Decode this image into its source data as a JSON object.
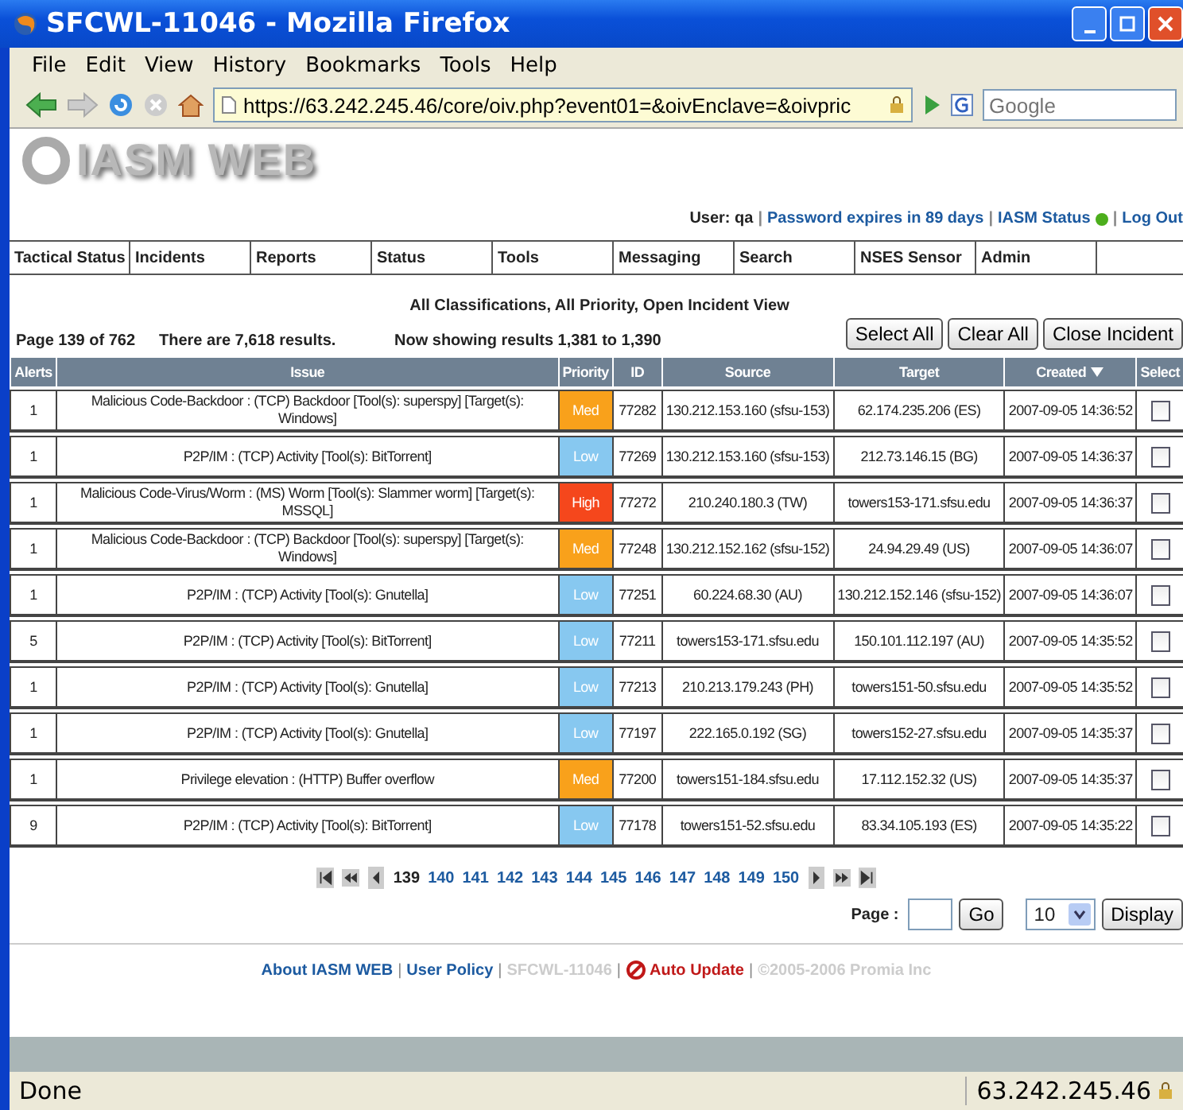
{
  "window": {
    "title": "SFCWL-11046 - Mozilla Firefox"
  },
  "menu": [
    "File",
    "Edit",
    "View",
    "History",
    "Bookmarks",
    "Tools",
    "Help"
  ],
  "address": "https://63.242.245.46/core/oiv.php?event01=&oivEnclave=&oivpric",
  "search": {
    "placeholder": "Google"
  },
  "header": {
    "logo": "IASM WEB",
    "items": [
      {
        "kind": "text",
        "text": "User: qa"
      },
      {
        "kind": "sep",
        "text": "|"
      },
      {
        "kind": "link",
        "text": "Password expires in 89 days"
      },
      {
        "kind": "sep",
        "text": "|"
      },
      {
        "kind": "link",
        "text": "IASM Status"
      },
      {
        "kind": "dot",
        "color": "#4cae1c"
      },
      {
        "kind": "sep",
        "text": "|"
      },
      {
        "kind": "link",
        "text": "Log Out"
      }
    ]
  },
  "tabs": [
    {
      "label": "Tactical Status"
    },
    {
      "label": "Incidents"
    },
    {
      "label": "Reports"
    },
    {
      "label": "Status"
    },
    {
      "label": "Tools"
    },
    {
      "label": "Messaging"
    },
    {
      "label": "Search"
    },
    {
      "label": "NSES Sensor"
    },
    {
      "label": "Admin"
    }
  ],
  "view_title": "All Classifications,  All  Priority, Open Incident View",
  "page_info": "Page 139 of 762",
  "results": "There are 7,618 results.",
  "showing": "Now showing results 1,381 to 1,390",
  "actions": [
    "Select All",
    "Clear All",
    "Close Incident"
  ],
  "columns": [
    "Alerts",
    "Issue",
    "Priority",
    "ID",
    "Source",
    "Target",
    "Created",
    "Select"
  ],
  "rows": [
    {
      "alerts": "1",
      "issue": "Malicious Code-Backdoor : (TCP) Backdoor [Tool(s): superspy] [Target(s): Windows]",
      "priority": {
        "text": "Med",
        "color": "#f9a11b"
      },
      "id": "77282",
      "source": "130.212.153.160 (sfsu-153)",
      "target": "62.174.235.206 (ES)",
      "created": "2007-09-05 14:36:52",
      "checked": false
    },
    {
      "alerts": "1",
      "issue": "P2P/IM : (TCP) Activity [Tool(s): BitTorrent]",
      "priority": {
        "text": "Low",
        "color": "#87c8f0"
      },
      "id": "77269",
      "source": "130.212.153.160 (sfsu-153)",
      "target": "212.73.146.15 (BG)",
      "created": "2007-09-05 14:36:37",
      "checked": false
    },
    {
      "alerts": "1",
      "issue": "Malicious Code-Virus/Worm : (MS) Worm [Tool(s): Slammer worm] [Target(s): MSSQL]",
      "priority": {
        "text": "High",
        "color": "#f5471c"
      },
      "id": "77272",
      "source": "210.240.180.3 (TW)",
      "target": "towers153-171.sfsu.edu",
      "created": "2007-09-05 14:36:37",
      "checked": false
    },
    {
      "alerts": "1",
      "issue": "Malicious Code-Backdoor : (TCP) Backdoor [Tool(s): superspy] [Target(s): Windows]",
      "priority": {
        "text": "Med",
        "color": "#f9a11b"
      },
      "id": "77248",
      "source": "130.212.152.162 (sfsu-152)",
      "target": "24.94.29.49 (US)",
      "created": "2007-09-05 14:36:07",
      "checked": false
    },
    {
      "alerts": "1",
      "issue": "P2P/IM : (TCP) Activity [Tool(s): Gnutella]",
      "priority": {
        "text": "Low",
        "color": "#87c8f0"
      },
      "id": "77251",
      "source": "60.224.68.30 (AU)",
      "target": "130.212.152.146 (sfsu-152)",
      "created": "2007-09-05 14:36:07",
      "checked": false
    },
    {
      "alerts": "5",
      "issue": "P2P/IM : (TCP) Activity [Tool(s): BitTorrent]",
      "priority": {
        "text": "Low",
        "color": "#87c8f0"
      },
      "id": "77211",
      "source": "towers153-171.sfsu.edu",
      "target": "150.101.112.197 (AU)",
      "created": "2007-09-05 14:35:52",
      "checked": false
    },
    {
      "alerts": "1",
      "issue": "P2P/IM : (TCP) Activity [Tool(s): Gnutella]",
      "priority": {
        "text": "Low",
        "color": "#87c8f0"
      },
      "id": "77213",
      "source": "210.213.179.243 (PH)",
      "target": "towers151-50.sfsu.edu",
      "created": "2007-09-05 14:35:52",
      "checked": false
    },
    {
      "alerts": "1",
      "issue": "P2P/IM : (TCP) Activity [Tool(s): Gnutella]",
      "priority": {
        "text": "Low",
        "color": "#87c8f0"
      },
      "id": "77197",
      "source": "222.165.0.192 (SG)",
      "target": "towers152-27.sfsu.edu",
      "created": "2007-09-05 14:35:37",
      "checked": false
    },
    {
      "alerts": "1",
      "issue": "Privilege elevation : (HTTP) Buffer overflow",
      "priority": {
        "text": "Med",
        "color": "#f9a11b"
      },
      "id": "77200",
      "source": "towers151-184.sfsu.edu",
      "target": "17.112.152.32 (US)",
      "created": "2007-09-05 14:35:37",
      "checked": false
    },
    {
      "alerts": "9",
      "issue": "P2P/IM : (TCP) Activity [Tool(s): BitTorrent]",
      "priority": {
        "text": "Low",
        "color": "#87c8f0"
      },
      "id": "77178",
      "source": "towers151-52.sfsu.edu",
      "target": "83.34.105.193 (ES)",
      "created": "2007-09-05 14:35:22",
      "checked": false
    }
  ],
  "pages": [
    {
      "label": "139",
      "selected": true
    },
    {
      "label": "140",
      "selected": false
    },
    {
      "label": "141",
      "selected": false
    },
    {
      "label": "142",
      "selected": false
    },
    {
      "label": "143",
      "selected": false
    },
    {
      "label": "144",
      "selected": false
    },
    {
      "label": "145",
      "selected": false
    },
    {
      "label": "146",
      "selected": false
    },
    {
      "label": "147",
      "selected": false
    },
    {
      "label": "148",
      "selected": false
    },
    {
      "label": "149",
      "selected": false
    },
    {
      "label": "150",
      "selected": false
    }
  ],
  "page_label": "Page :",
  "go": "Go",
  "per_page": "10",
  "display": "Display",
  "footer": [
    {
      "kind": "link",
      "text": "About IASM WEB"
    },
    {
      "kind": "sep",
      "text": "|"
    },
    {
      "kind": "link",
      "text": "User Policy"
    },
    {
      "kind": "sep",
      "text": "|"
    },
    {
      "kind": "muted",
      "text": "SFCWL-11046"
    },
    {
      "kind": "sep",
      "text": "|"
    },
    {
      "kind": "alert",
      "text": "Auto Update"
    },
    {
      "kind": "sep",
      "text": "|"
    },
    {
      "kind": "muted",
      "text": "©2005-2006 Promia Inc"
    }
  ],
  "status_bar": {
    "text": "Done",
    "host": "63.242.245.46"
  }
}
